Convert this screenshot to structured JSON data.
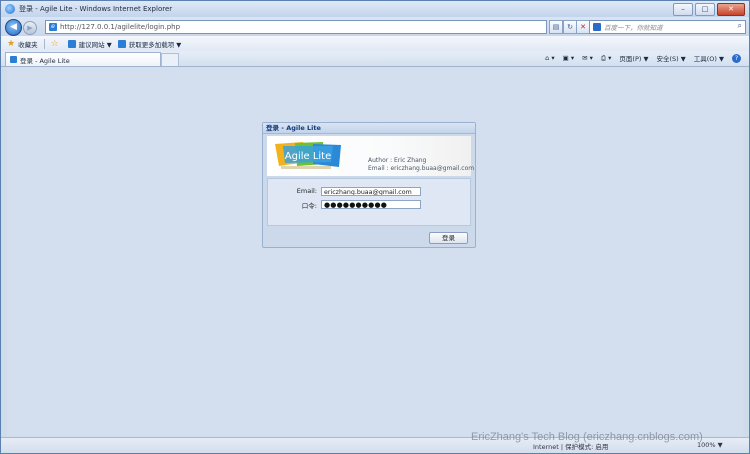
{
  "window": {
    "title": "登录 - Agile Lite - Windows Internet Explorer",
    "minimize": "–",
    "maximize": "□",
    "close": "✕"
  },
  "address": {
    "url": "http://127.0.0.1/agilelite/login.php",
    "search_placeholder": "百度一下，你就知道"
  },
  "favorites": {
    "favorites_label": "收藏夹",
    "suggested_label": "建议网站 ▼",
    "more_addons_label": "获取更多加载项 ▼"
  },
  "tab": {
    "label": "登录 - Agile Lite"
  },
  "commands": {
    "page": "页面(P) ▼",
    "safety": "安全(S) ▼",
    "tools": "工具(O) ▼",
    "help": "?"
  },
  "dialog": {
    "title": "登录 - Agile Lite",
    "logo_text": "Agile Lite",
    "author": "Author : Eric Zhang",
    "email_info": "Email : ericzhang.buaa@gmail.com",
    "email_label": "Email:",
    "email_value": "ericzhang.buaa@gmail.com",
    "password_label": "口令:",
    "password_value": "●●●●●●●●●●",
    "login_button": "登录"
  },
  "status": {
    "text": "Internet | 保护模式: 启用",
    "zoom": "100% ▼"
  },
  "watermark": "EricZhang's Tech Blog (ericzhang.cnblogs.com)"
}
